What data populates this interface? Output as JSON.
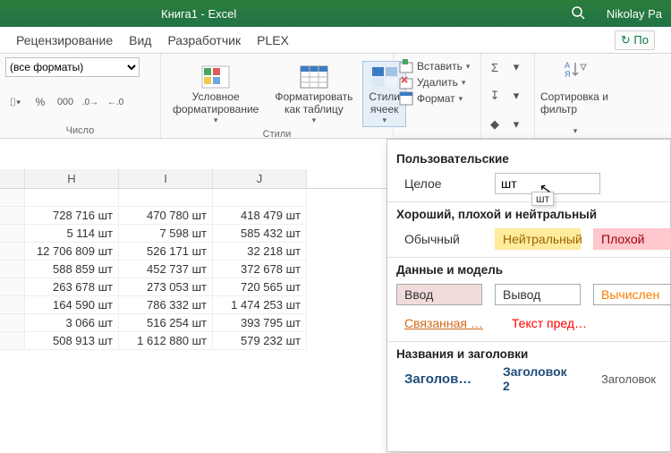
{
  "titlebar": {
    "title": "Книга1  -  Excel",
    "user": "Nikolay Pa"
  },
  "tabs": {
    "t1": "Рецензирование",
    "t2": "Вид",
    "t3": "Разработчик",
    "t4": "PLEX",
    "share": "По"
  },
  "number_group": {
    "format_selected": "(все форматы)",
    "label": "Число"
  },
  "styles_group": {
    "cond": "Условное форматирование",
    "astable": "Форматировать как таблицу",
    "cellstyles": "Стили ячеек",
    "label": "Стили"
  },
  "cells_group": {
    "insert": "Вставить",
    "delete": "Удалить",
    "format": "Формат"
  },
  "sort_group": {
    "label": "Сортировка и фильтр"
  },
  "columns": {
    "h": "H",
    "i": "I",
    "j": "J"
  },
  "table": [
    {
      "h": "728 716 шт",
      "i": "470 780 шт",
      "j": "418 479 шт"
    },
    {
      "h": "5 114 шт",
      "i": "7 598 шт",
      "j": "585 432 шт"
    },
    {
      "h": "12 706 809 шт",
      "i": "526 171 шт",
      "j": "32 218 шт"
    },
    {
      "h": "588 859 шт",
      "i": "452 737 шт",
      "j": "372 678 шт"
    },
    {
      "h": "263 678 шт",
      "i": "273 053 шт",
      "j": "720 565 шт"
    },
    {
      "h": "164 590 шт",
      "i": "786 332 шт",
      "j": "1 474 253 шт"
    },
    {
      "h": "3 066 шт",
      "i": "516 254 шт",
      "j": "393 795 шт"
    },
    {
      "h": "508 913 шт",
      "i": "1 612 880 шт",
      "j": "579 232 шт"
    }
  ],
  "styles_pane": {
    "sec_user": "Пользовательские",
    "user_style": "Целое",
    "user_input": "шт",
    "tooltip": "шт",
    "sec_gbq": "Хороший, плохой и нейтральный",
    "normal": "Обычный",
    "neutral": "Нейтральный",
    "bad": "Плохой",
    "sec_data": "Данные и модель",
    "input": "Ввод",
    "output": "Вывод",
    "calc": "Вычислен",
    "linked": "Связанная …",
    "warn": "Текст пред…",
    "sec_head": "Названия и заголовки",
    "h1": "Заголов…",
    "h2": "Заголовок 2",
    "h3": "Заголовок"
  }
}
